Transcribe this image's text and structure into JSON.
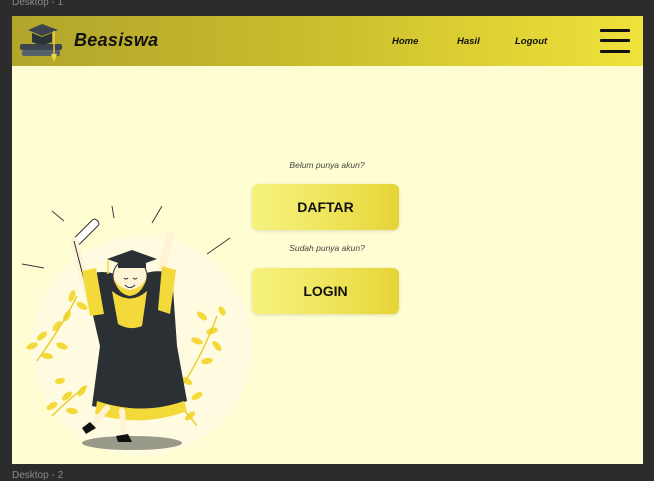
{
  "canvas": {
    "frame_label_top": "Desktop - 1",
    "frame_label_bottom": "Desktop - 2"
  },
  "navbar": {
    "brand": "Beasiswa",
    "links": [
      {
        "label": "Home"
      },
      {
        "label": "Hasil"
      },
      {
        "label": "Logout"
      }
    ],
    "menu_icon": "hamburger-menu-icon",
    "logo_icon": "graduation-cap-logo-icon"
  },
  "main": {
    "register_hint": "Belum punya akun?",
    "register_button": "DAFTAR",
    "login_hint": "Sudah punya akun?",
    "login_button": "LOGIN",
    "illustration": "graduate-celebrating-illustration"
  },
  "colors": {
    "page_background": "#fffed3",
    "navbar_gradient_start": "#b1a52c",
    "navbar_gradient_end": "#efe23a",
    "button_gradient_start": "#f6f27f",
    "button_gradient_end": "#e6d436",
    "accent_yellow": "#f4d93a",
    "gown": "#2b3035"
  }
}
